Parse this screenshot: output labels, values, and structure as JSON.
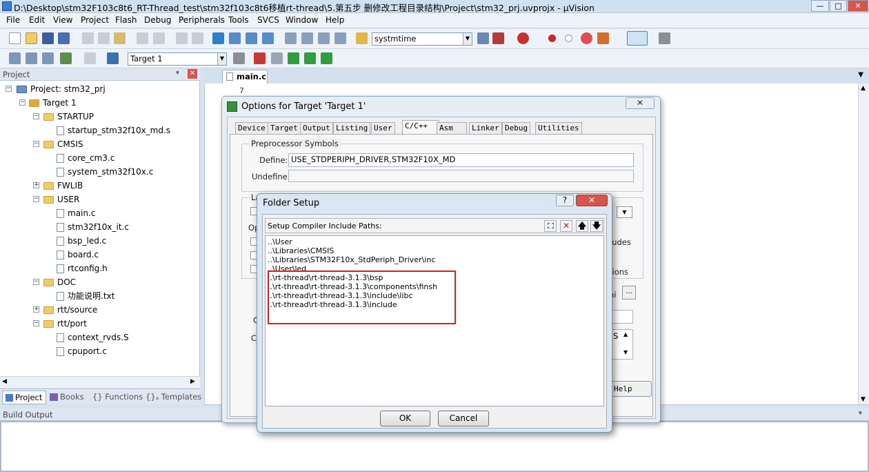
{
  "window": {
    "title": "D:\\Desktop\\stm32F103c8t6_RT-Thread_test\\stm32f103c8t6移植rt-thread\\5.第五步 删修改工程目录结构\\Project\\stm32_prj.uvprojx - µVision",
    "minimize": "—",
    "maximize": "□",
    "close": "✕"
  },
  "menu": [
    "File",
    "Edit",
    "View",
    "Project",
    "Flash",
    "Debug",
    "Peripherals",
    "Tools",
    "SVCS",
    "Window",
    "Help"
  ],
  "toolbar1": {
    "search_value": "systmtime"
  },
  "toolbar2": {
    "target_value": "Target 1"
  },
  "project_panel": {
    "title": "Project",
    "pin": "ᵠ",
    "close": "✕",
    "tree": [
      {
        "label": "Project: stm32_prj",
        "depth": 0,
        "kind": "project",
        "toggle": "−"
      },
      {
        "label": "Target 1",
        "depth": 1,
        "kind": "target",
        "toggle": "−"
      },
      {
        "label": "STARTUP",
        "depth": 2,
        "kind": "folder",
        "toggle": "−"
      },
      {
        "label": "startup_stm32f10x_md.s",
        "depth": 3,
        "kind": "file"
      },
      {
        "label": "CMSIS",
        "depth": 2,
        "kind": "folder",
        "toggle": "−"
      },
      {
        "label": "core_cm3.c",
        "depth": 3,
        "kind": "file"
      },
      {
        "label": "system_stm32f10x.c",
        "depth": 3,
        "kind": "file"
      },
      {
        "label": "FWLIB",
        "depth": 2,
        "kind": "folder",
        "toggle": "+"
      },
      {
        "label": "USER",
        "depth": 2,
        "kind": "folder",
        "toggle": "−"
      },
      {
        "label": "main.c",
        "depth": 3,
        "kind": "file"
      },
      {
        "label": "stm32f10x_it.c",
        "depth": 3,
        "kind": "file"
      },
      {
        "label": "bsp_led.c",
        "depth": 3,
        "kind": "file"
      },
      {
        "label": "board.c",
        "depth": 3,
        "kind": "file"
      },
      {
        "label": "rtconfig.h",
        "depth": 3,
        "kind": "file"
      },
      {
        "label": "DOC",
        "depth": 2,
        "kind": "folder",
        "toggle": "−"
      },
      {
        "label": "功能说明.txt",
        "depth": 3,
        "kind": "file"
      },
      {
        "label": "rtt/source",
        "depth": 2,
        "kind": "folder",
        "toggle": "+"
      },
      {
        "label": "rtt/port",
        "depth": 2,
        "kind": "folder",
        "toggle": "−"
      },
      {
        "label": "context_rvds.S",
        "depth": 3,
        "kind": "file"
      },
      {
        "label": "cpuport.c",
        "depth": 3,
        "kind": "file"
      }
    ],
    "tabs": [
      "Project",
      "Books",
      "{} Functions",
      "{}ₐ Templates"
    ]
  },
  "editor": {
    "tab": "main.c",
    "line_number": "7"
  },
  "build_output": {
    "title": "Build Output"
  },
  "options_dialog": {
    "title": "Options for Target 'Target 1'",
    "close": "✕",
    "tabs": [
      "Device",
      "Target",
      "Output",
      "Listing",
      "User",
      "C/C++",
      "Asm",
      "Linker",
      "Debug",
      "Utilities"
    ],
    "active_tab": "C/C++",
    "preprocessor_group": "Preprocessor Symbols",
    "define_label": "Define:",
    "define_value": "USE_STDPERIPH_DRIVER,STM32F10X_MD",
    "undefine_label": "Undefine:",
    "lang_group_partial": "La",
    "opt_partial": "Op",
    "includes_partial": "ludes",
    "options_partial": "tions",
    "include_partial": "I",
    "inc_field_partial": "hi",
    "browse": "...",
    "misc_partial": "C",
    "controls_partial": "Co",
    "s_partial": "S",
    "help_partial": "Help"
  },
  "folder_dialog": {
    "title": "Folder Setup",
    "help": "?",
    "close": "✕",
    "header_label": "Setup Compiler Include Paths:",
    "paths": [
      "..\\User",
      "..\\Libraries\\CMSIS",
      "..\\Libraries\\STM32F10x_StdPeriph_Driver\\inc",
      "..\\User\\led",
      "..\\rt-thread\\rt-thread-3.1.3\\bsp",
      "..\\rt-thread\\rt-thread-3.1.3\\components\\finsh",
      "..\\rt-thread\\rt-thread-3.1.3\\include\\libc",
      "..\\rt-thread\\rt-thread-3.1.3\\include"
    ],
    "ok": "OK",
    "cancel": "Cancel"
  }
}
